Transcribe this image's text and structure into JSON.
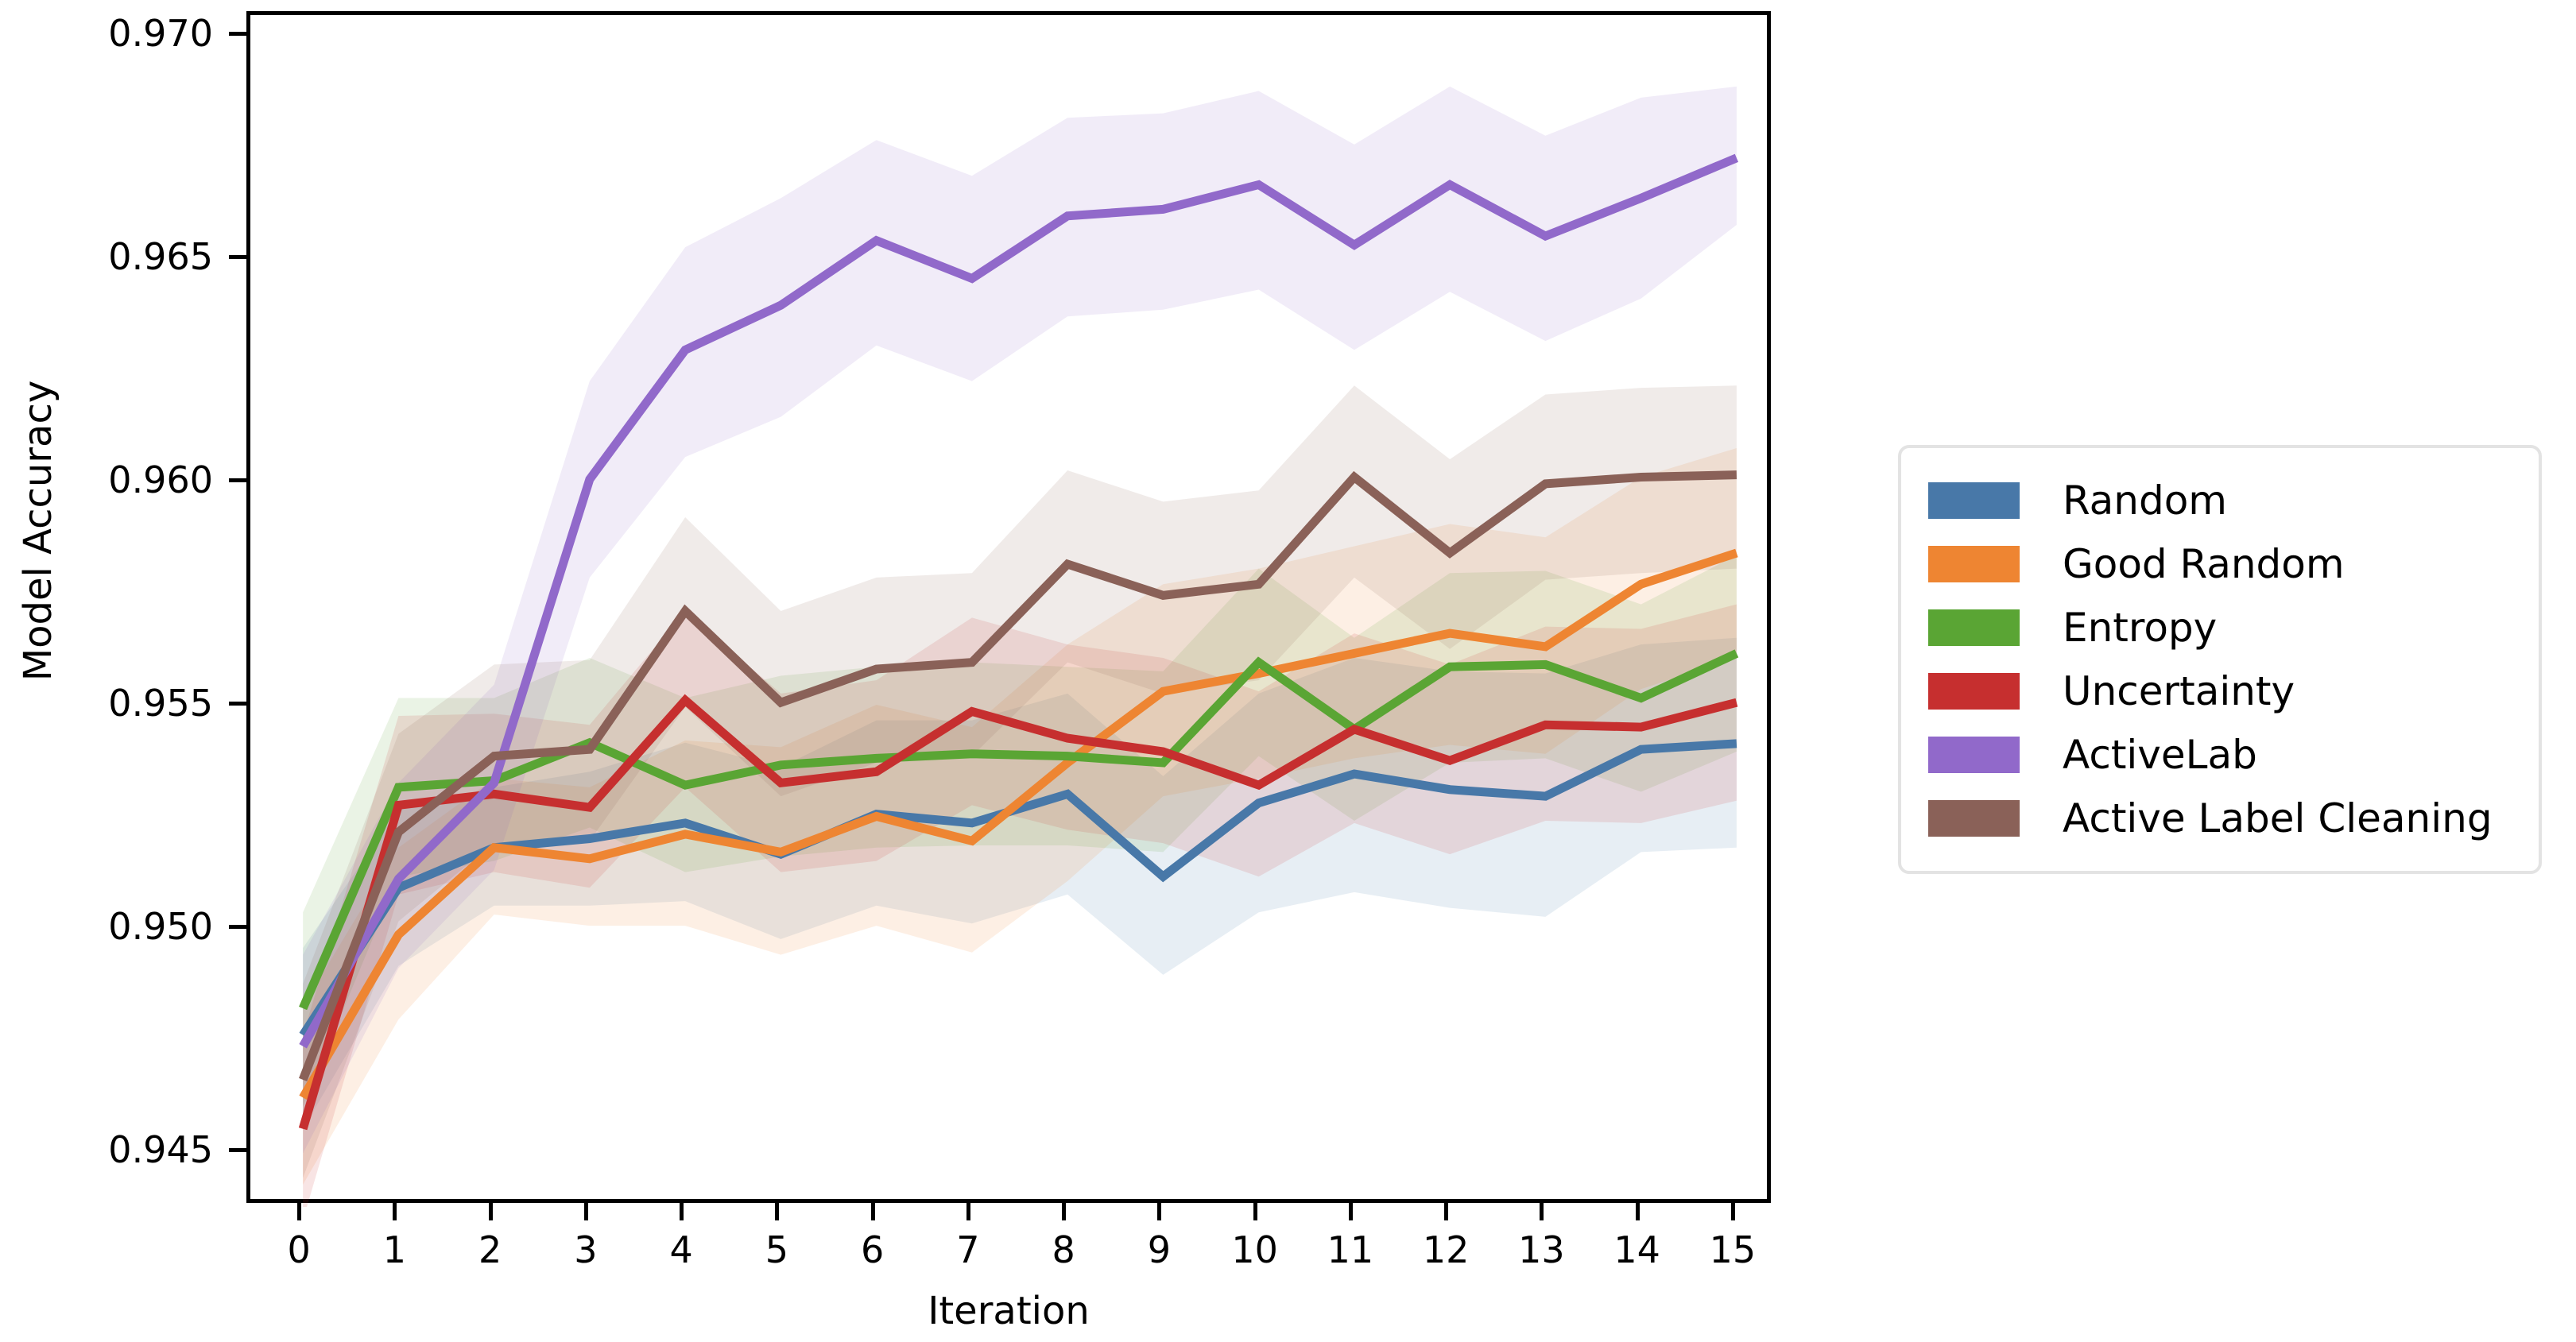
{
  "chart_data": {
    "type": "line",
    "title": "",
    "xlabel": "Iteration",
    "ylabel": "Model Accuracy",
    "xlim": [
      -0.55,
      15.4
    ],
    "ylim": [
      0.9438,
      0.9705
    ],
    "xticks": [
      0,
      1,
      2,
      3,
      4,
      5,
      6,
      7,
      8,
      9,
      10,
      11,
      12,
      13,
      14,
      15
    ],
    "xtick_labels": [
      "0",
      "1",
      "2",
      "3",
      "4",
      "5",
      "6",
      "7",
      "8",
      "9",
      "10",
      "11",
      "12",
      "13",
      "14",
      "15"
    ],
    "yticks": [
      0.945,
      0.95,
      0.955,
      0.96,
      0.965,
      0.97
    ],
    "ytick_labels": [
      "0.945",
      "0.950",
      "0.955",
      "0.960",
      "0.965",
      "0.970"
    ],
    "grid": false,
    "legend_position": "right",
    "x": [
      0,
      1,
      2,
      3,
      4,
      5,
      6,
      7,
      8,
      9,
      10,
      11,
      12,
      13,
      14,
      15
    ],
    "series": [
      {
        "name": "Random",
        "color": "#4878a8",
        "band_color": "#4878a8",
        "values": [
          0.94765,
          0.95095,
          0.95185,
          0.95205,
          0.9524,
          0.9517,
          0.9526,
          0.9524,
          0.95305,
          0.9512,
          0.95285,
          0.9535,
          0.95315,
          0.953,
          0.95405,
          0.95418
        ],
        "band_lo": [
          0.94555,
          0.9492,
          0.95055,
          0.95055,
          0.95065,
          0.9498,
          0.95055,
          0.95015,
          0.9508,
          0.949,
          0.9504,
          0.95085,
          0.9505,
          0.9503,
          0.95175,
          0.95185
        ],
        "band_hi": [
          0.9496,
          0.9527,
          0.9532,
          0.95355,
          0.9542,
          0.95365,
          0.9547,
          0.9547,
          0.9553,
          0.95345,
          0.9553,
          0.9561,
          0.9558,
          0.95575,
          0.9564,
          0.95655
        ]
      },
      {
        "name": "Good Random",
        "color": "#ee8532",
        "band_color": "#ee8532",
        "values": [
          0.94625,
          0.9499,
          0.95185,
          0.9516,
          0.95215,
          0.95175,
          0.95255,
          0.952,
          0.95375,
          0.95535,
          0.95575,
          0.9562,
          0.95665,
          0.95635,
          0.95775,
          0.95845
        ],
        "band_lo": [
          0.9443,
          0.948,
          0.95035,
          0.9501,
          0.9501,
          0.94945,
          0.9501,
          0.9495,
          0.9511,
          0.953,
          0.9534,
          0.95385,
          0.95415,
          0.95395,
          0.9554,
          0.9561
        ],
        "band_hi": [
          0.9483,
          0.95185,
          0.9534,
          0.9532,
          0.95425,
          0.9541,
          0.95505,
          0.95455,
          0.9564,
          0.95775,
          0.9581,
          0.9586,
          0.9591,
          0.9588,
          0.96015,
          0.9608
        ]
      },
      {
        "name": "Entropy",
        "color": "#5aa534",
        "band_color": "#5aa534",
        "values": [
          0.94825,
          0.9532,
          0.95335,
          0.9542,
          0.95325,
          0.9537,
          0.95385,
          0.95395,
          0.9539,
          0.95375,
          0.956,
          0.9545,
          0.9559,
          0.95595,
          0.9552,
          0.9562
        ],
        "band_lo": [
          0.94605,
          0.9512,
          0.95155,
          0.9523,
          0.9513,
          0.95165,
          0.95185,
          0.9519,
          0.9519,
          0.95175,
          0.9539,
          0.95245,
          0.95375,
          0.95385,
          0.9531,
          0.954
        ],
        "band_hi": [
          0.9504,
          0.9552,
          0.9552,
          0.9561,
          0.9552,
          0.9557,
          0.9559,
          0.956,
          0.9559,
          0.9558,
          0.9581,
          0.95655,
          0.958,
          0.95805,
          0.9573,
          0.9584
        ]
      },
      {
        "name": "Uncertainty",
        "color": "#c62f2f",
        "band_color": "#c62f2f",
        "values": [
          0.94555,
          0.9528,
          0.95305,
          0.95275,
          0.95515,
          0.9533,
          0.95355,
          0.9549,
          0.9543,
          0.954,
          0.95325,
          0.9545,
          0.9538,
          0.9546,
          0.95455,
          0.9551
        ],
        "band_lo": [
          0.9435,
          0.9508,
          0.9513,
          0.95095,
          0.9532,
          0.9513,
          0.95155,
          0.9528,
          0.95225,
          0.95195,
          0.9512,
          0.9524,
          0.9517,
          0.95245,
          0.9524,
          0.9529
        ],
        "band_hi": [
          0.94765,
          0.9548,
          0.95485,
          0.9546,
          0.95715,
          0.9553,
          0.9556,
          0.957,
          0.9564,
          0.9561,
          0.95535,
          0.95665,
          0.95595,
          0.9568,
          0.95675,
          0.9573
        ]
      },
      {
        "name": "ActiveLab",
        "color": "#9169ca",
        "band_color": "#9169ca",
        "values": [
          0.9474,
          0.95115,
          0.9533,
          0.9601,
          0.963,
          0.964,
          0.96545,
          0.9646,
          0.966,
          0.96615,
          0.9667,
          0.96535,
          0.9667,
          0.96555,
          0.9664,
          0.9673
        ],
        "band_lo": [
          0.945,
          0.94915,
          0.95135,
          0.9579,
          0.9606,
          0.9615,
          0.9631,
          0.9623,
          0.96375,
          0.9639,
          0.96435,
          0.963,
          0.9643,
          0.9632,
          0.96415,
          0.9658
        ],
        "band_hi": [
          0.94945,
          0.9533,
          0.9555,
          0.9623,
          0.9653,
          0.9664,
          0.9677,
          0.9669,
          0.9682,
          0.9683,
          0.9688,
          0.9676,
          0.9689,
          0.9678,
          0.96865,
          0.9689
        ]
      },
      {
        "name": "Active Label Cleaning",
        "color": "#8a6158",
        "band_color": "#8a6158",
        "values": [
          0.94665,
          0.9522,
          0.9539,
          0.95405,
          0.95715,
          0.9551,
          0.95585,
          0.956,
          0.9582,
          0.9575,
          0.95775,
          0.96015,
          0.95845,
          0.96,
          0.96015,
          0.9602
        ],
        "band_lo": [
          0.94445,
          0.9502,
          0.95195,
          0.952,
          0.955,
          0.953,
          0.95375,
          0.9539,
          0.956,
          0.9553,
          0.9556,
          0.9579,
          0.9563,
          0.95785,
          0.958,
          0.9581
        ],
        "band_hi": [
          0.9488,
          0.9544,
          0.95595,
          0.95605,
          0.95925,
          0.95715,
          0.9579,
          0.958,
          0.9603,
          0.9596,
          0.95985,
          0.9622,
          0.96055,
          0.962,
          0.96215,
          0.9622
        ]
      }
    ]
  },
  "axes": {
    "y_title": "Model Accuracy",
    "x_title": "Iteration"
  },
  "legend": {
    "items": [
      {
        "label": "Random",
        "color": "#4878a8"
      },
      {
        "label": "Good Random",
        "color": "#ee8532"
      },
      {
        "label": "Entropy",
        "color": "#5aa534"
      },
      {
        "label": "Uncertainty",
        "color": "#c62f2f"
      },
      {
        "label": "ActiveLab",
        "color": "#9169ca"
      },
      {
        "label": "Active Label Cleaning",
        "color": "#8a6158"
      }
    ]
  }
}
